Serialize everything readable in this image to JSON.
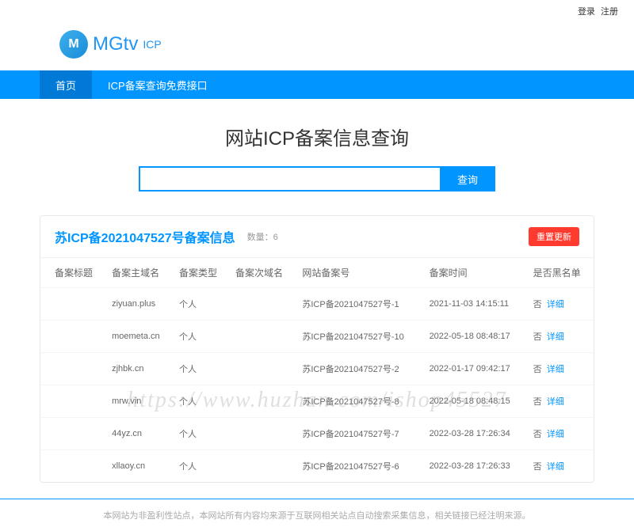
{
  "top": {
    "login": "登录",
    "register": "注册"
  },
  "logo": {
    "brand": "MGtv",
    "sub": "ICP"
  },
  "nav": {
    "home": "首页",
    "api": "ICP备案查询免费接口"
  },
  "title": "网站ICP备案信息查询",
  "search": {
    "btn": "查询"
  },
  "panel": {
    "title": "苏ICP备2021047527号备案信息",
    "count_label": "数量：6",
    "refresh": "重置更新"
  },
  "columns": {
    "c1": "备案标题",
    "c2": "备案主域名",
    "c3": "备案类型",
    "c4": "备案次域名",
    "c5": "网站备案号",
    "c6": "备案时间",
    "c7": "是否黑名单"
  },
  "rows": [
    {
      "domain": "ziyuan.plus",
      "type": "个人",
      "sub": "",
      "icp": "苏ICP备2021047527号-1",
      "time": "2021-11-03 14:15:11",
      "black": "否",
      "detail": "详细"
    },
    {
      "domain": "moemeta.cn",
      "type": "个人",
      "sub": "",
      "icp": "苏ICP备2021047527号-10",
      "time": "2022-05-18 08:48:17",
      "black": "否",
      "detail": "详细"
    },
    {
      "domain": "zjhbk.cn",
      "type": "个人",
      "sub": "",
      "icp": "苏ICP备2021047527号-2",
      "time": "2022-01-17 09:42:17",
      "black": "否",
      "detail": "详细"
    },
    {
      "domain": "mrw.vin",
      "type": "个人",
      "sub": "",
      "icp": "苏ICP备2021047527号-8",
      "time": "2022-05-18 08:48:15",
      "black": "否",
      "detail": "详细"
    },
    {
      "domain": "44yz.cn",
      "type": "个人",
      "sub": "",
      "icp": "苏ICP备2021047527号-7",
      "time": "2022-03-28 17:26:34",
      "black": "否",
      "detail": "详细"
    },
    {
      "domain": "xllaoy.cn",
      "type": "个人",
      "sub": "",
      "icp": "苏ICP备2021047527号-6",
      "time": "2022-03-28 17:26:33",
      "black": "否",
      "detail": "详细"
    }
  ],
  "footer": "本网站为非盈利性站点，本网站所有内容均来源于互联网相关站点自动搜索采集信息，相关链接已经注明来源。",
  "watermark": "https://www.huzhan.com/ishop45527"
}
